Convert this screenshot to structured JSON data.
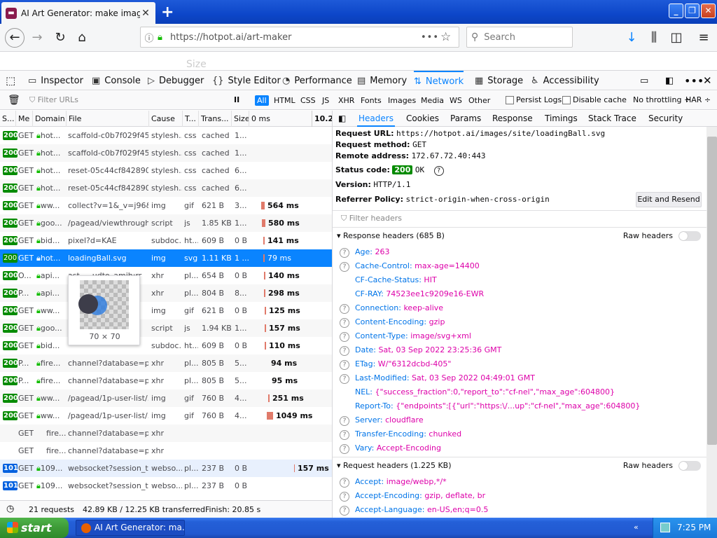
{
  "window": {
    "tab_title": "AI Art Generator: make images w",
    "favicon": "hotpot-favicon",
    "new_tab": "+"
  },
  "nav": {
    "url_prefix": "https://hotpot.ai",
    "url_path": "/art-maker",
    "more": "•••",
    "search_placeholder": "Search"
  },
  "page_peek": "Size",
  "devtools": {
    "tabs": [
      {
        "label": "Inspector",
        "icon": "inspector-icon"
      },
      {
        "label": "Console",
        "icon": "console-icon"
      },
      {
        "label": "Debugger",
        "icon": "debugger-icon"
      },
      {
        "label": "Style Editor",
        "icon": "braces-icon"
      },
      {
        "label": "Performance",
        "icon": "performance-icon"
      },
      {
        "label": "Memory",
        "icon": "memory-icon"
      },
      {
        "label": "Network",
        "icon": "network-icon"
      },
      {
        "label": "Storage",
        "icon": "storage-icon"
      },
      {
        "label": "Accessibility",
        "icon": "accessibility-icon"
      }
    ],
    "selected_tab": "Network"
  },
  "filter": {
    "placeholder": "Filter URLs",
    "pause": "II",
    "types": [
      "All",
      "HTML",
      "CSS",
      "JS",
      "XHR",
      "Fonts",
      "Images",
      "Media",
      "WS",
      "Other"
    ],
    "selected_type": "All",
    "persist_logs": "Persist Logs",
    "disable_cache": "Disable cache",
    "throttling": "No throttling ÷",
    "har": "HAR ÷"
  },
  "columns": [
    "S...",
    "Me",
    "Domain",
    "File",
    "Cause",
    "T...",
    "Trans...",
    "Size",
    "0 ms",
    "10.2"
  ],
  "requests": [
    {
      "status": "200",
      "method": "GET",
      "domain": "hot...",
      "file": "scaffold-c0b7f029f45...",
      "cause": "stylesh...",
      "type": "css",
      "transferred": "cached",
      "size": "1...",
      "wf": "",
      "wfw": 0,
      "wfx": 0,
      "lock": true,
      "faded": true
    },
    {
      "status": "200",
      "method": "GET",
      "domain": "hot...",
      "file": "scaffold-c0b7f029f45...",
      "cause": "stylesh...",
      "type": "css",
      "transferred": "cached",
      "size": "1...",
      "wf": "",
      "wfw": 0,
      "wfx": 0,
      "lock": true,
      "faded": true
    },
    {
      "status": "200",
      "method": "GET",
      "domain": "hot...",
      "file": "reset-05c44cf842890...",
      "cause": "stylesh...",
      "type": "css",
      "transferred": "cached",
      "size": "6...",
      "wf": "",
      "wfw": 0,
      "wfx": 0,
      "lock": true,
      "faded": true
    },
    {
      "status": "200",
      "method": "GET",
      "domain": "hot...",
      "file": "reset-05c44cf842890...",
      "cause": "stylesh...",
      "type": "css",
      "transferred": "cached",
      "size": "6...",
      "wf": "",
      "wfw": 0,
      "wfx": 0,
      "lock": true,
      "faded": true
    },
    {
      "status": "200",
      "method": "GET",
      "domain": "ww...",
      "file": "collect?v=1&_v=j96&...",
      "cause": "img",
      "type": "gif",
      "transferred": "621 B",
      "size": "3...",
      "wf": "564 ms",
      "wfw": 5,
      "wfx": 373,
      "lock": true
    },
    {
      "status": "200",
      "method": "GET",
      "domain": "goo...",
      "file": "/pagead/viewthrough...",
      "cause": "script",
      "type": "js",
      "transferred": "1.85 KB",
      "size": "1...",
      "wf": "580 ms",
      "wfw": 5,
      "wfx": 374,
      "lock": true
    },
    {
      "status": "200",
      "method": "GET",
      "domain": "bid...",
      "file": "pixel?d=KAE",
      "cause": "subdoc...",
      "type": "ht...",
      "transferred": "609 B",
      "size": "0 B",
      "wf": "141 ms",
      "wfw": 2,
      "wfx": 376,
      "lock": true
    },
    {
      "status": "200",
      "method": "GET",
      "domain": "hot...",
      "file": "loadingBall.svg",
      "cause": "img",
      "type": "svg",
      "transferred": "1.11 KB",
      "size": "1 ...",
      "wf": "79 ms",
      "wfw": 2,
      "wfx": 376,
      "lock": true,
      "selected": true
    },
    {
      "status": "200",
      "method": "O...",
      "domain": "api...",
      "file": "ast-... udto_amih:rr",
      "cause": "xhr",
      "type": "pl...",
      "transferred": "654 B",
      "size": "0 B",
      "wf": "140 ms",
      "wfw": 2,
      "wfx": 377,
      "lock": true
    },
    {
      "status": "200",
      "method": "P...",
      "domain": "api...",
      "file": "...rr",
      "cause": "xhr",
      "type": "pl...",
      "transferred": "804 B",
      "size": "8...",
      "wf": "298 ms",
      "wfw": 2,
      "wfx": 377,
      "lock": true
    },
    {
      "status": "200",
      "method": "GET",
      "domain": "ww...",
      "file": "",
      "cause": "img",
      "type": "gif",
      "transferred": "621 B",
      "size": "0 B",
      "wf": "125 ms",
      "wfw": 2,
      "wfx": 378,
      "lock": true
    },
    {
      "status": "200",
      "method": "GET",
      "domain": "goo...",
      "file": "",
      "cause": "script",
      "type": "js",
      "transferred": "1.94 KB",
      "size": "1...",
      "wf": "157 ms",
      "wfw": 2,
      "wfx": 378,
      "lock": true
    },
    {
      "status": "200",
      "method": "GET",
      "domain": "bid...",
      "file": "",
      "cause": "subdoc...",
      "type": "ht...",
      "transferred": "609 B",
      "size": "0 B",
      "wf": "110 ms",
      "wfw": 2,
      "wfx": 378,
      "lock": true
    },
    {
      "status": "200",
      "method": "P...",
      "domain": "fire...",
      "file": "channel?database=pr...",
      "cause": "xhr",
      "type": "pl...",
      "transferred": "805 B",
      "size": "5...",
      "wf": "94 ms",
      "wfw": 0,
      "wfx": 383,
      "lock": true
    },
    {
      "status": "200",
      "method": "P...",
      "domain": "fire...",
      "file": "channel?database=pr...",
      "cause": "xhr",
      "type": "pl...",
      "transferred": "805 B",
      "size": "5...",
      "wf": "95 ms",
      "wfw": 0,
      "wfx": 384,
      "lock": true
    },
    {
      "status": "200",
      "method": "GET",
      "domain": "ww...",
      "file": "/pagead/1p-user-list/...",
      "cause": "img",
      "type": "gif",
      "transferred": "760 B",
      "size": "4...",
      "wf": "251 ms",
      "wfw": 2,
      "wfx": 383,
      "lock": true
    },
    {
      "status": "200",
      "method": "GET",
      "domain": "ww...",
      "file": "/pagead/1p-user-list/...",
      "cause": "img",
      "type": "gif",
      "transferred": "760 B",
      "size": "4...",
      "wf": "1049 ms",
      "wfw": 9,
      "wfx": 381,
      "lock": true
    },
    {
      "status": "",
      "method": "GET",
      "domain": "fire...",
      "file": "channel?database=pr...",
      "cause": "xhr",
      "type": "",
      "transferred": "",
      "size": "",
      "wf": "",
      "wfw": 0,
      "wfx": 0,
      "lock": false
    },
    {
      "status": "",
      "method": "GET",
      "domain": "fire...",
      "file": "channel?database=pr...",
      "cause": "xhr",
      "type": "",
      "transferred": "",
      "size": "",
      "wf": "",
      "wfw": 0,
      "wfx": 0,
      "lock": false
    },
    {
      "status": "101",
      "method": "GET",
      "domain": "109...",
      "file": "websocket?session_t...",
      "cause": "webso...",
      "type": "pl...",
      "transferred": "237 B",
      "size": "0 B",
      "wf": "157 ms",
      "wfw": 1,
      "wfx": 420,
      "lock": true,
      "ws": true
    },
    {
      "status": "101",
      "method": "GET",
      "domain": "109...",
      "file": "websocket?session_t...",
      "cause": "webso...",
      "type": "pl...",
      "transferred": "237 B",
      "size": "0 B",
      "wf": "",
      "wfw": 0,
      "wfx": 0,
      "lock": true
    }
  ],
  "tooltip_dims": "70 × 70",
  "footer": {
    "requests": "21 requests",
    "transferred": "42.89 KB / 12.25 KB transferred",
    "finish": "Finish: 20.85 s"
  },
  "detail": {
    "tabs": [
      "Headers",
      "Cookies",
      "Params",
      "Response",
      "Timings",
      "Stack Trace",
      "Security"
    ],
    "selected_tab": "Headers",
    "request_url_label": "Request URL:",
    "request_url": "https://hotpot.ai/images/site/loadingBall.svg",
    "request_method_label": "Request method:",
    "request_method": "GET",
    "remote_label": "Remote address:",
    "remote": "172.67.72.40:443",
    "status_label": "Status code:",
    "status_code": "200",
    "status_text": "OK",
    "version_label": "Version:",
    "version": "HTTP/1.1",
    "referrer_label": "Referrer Policy:",
    "referrer": "strict-origin-when-cross-origin",
    "edit_resend": "Edit and Resend",
    "filter_headers": "Filter headers",
    "response_headers_title": "Response headers (685 B)",
    "request_headers_title": "Request headers (1.225 KB)",
    "raw_headers": "Raw headers",
    "response_headers": [
      {
        "name": "Age:",
        "value": "263",
        "help": true
      },
      {
        "name": "Cache-Control:",
        "value": "max-age=14400",
        "help": true
      },
      {
        "name": "CF-Cache-Status:",
        "value": "HIT",
        "help": false
      },
      {
        "name": "CF-RAY:",
        "value": "74523ee1c9209e16-EWR",
        "help": false
      },
      {
        "name": "Connection:",
        "value": "keep-alive",
        "help": true
      },
      {
        "name": "Content-Encoding:",
        "value": "gzip",
        "help": true
      },
      {
        "name": "Content-Type:",
        "value": "image/svg+xml",
        "help": true
      },
      {
        "name": "Date:",
        "value": "Sat, 03 Sep 2022 23:25:36 GMT",
        "help": true
      },
      {
        "name": "ETag:",
        "value": "W/\"6312dcbd-405\"",
        "help": true
      },
      {
        "name": "Last-Modified:",
        "value": "Sat, 03 Sep 2022 04:49:01 GMT",
        "help": true
      },
      {
        "name": "NEL:",
        "value": "{\"success_fraction\":0,\"report_to\":\"cf-nel\",\"max_age\":604800}",
        "help": false
      },
      {
        "name": "Report-To:",
        "value": "{\"endpoints\":[{\"url\":\"https:\\/...up\":\"cf-nel\",\"max_age\":604800}",
        "help": false
      },
      {
        "name": "Server:",
        "value": "cloudflare",
        "help": true
      },
      {
        "name": "Transfer-Encoding:",
        "value": "chunked",
        "help": true
      },
      {
        "name": "Vary:",
        "value": "Accept-Encoding",
        "help": true
      }
    ],
    "request_headers": [
      {
        "name": "Accept:",
        "value": "image/webp,*/*",
        "help": true
      },
      {
        "name": "Accept-Encoding:",
        "value": "gzip, deflate, br",
        "help": true
      },
      {
        "name": "Accept-Language:",
        "value": "en-US,en;q=0.5",
        "help": true
      }
    ]
  },
  "taskbar": {
    "start": "start",
    "task": "AI Art Generator: ma...",
    "clock": "7:25 PM"
  }
}
